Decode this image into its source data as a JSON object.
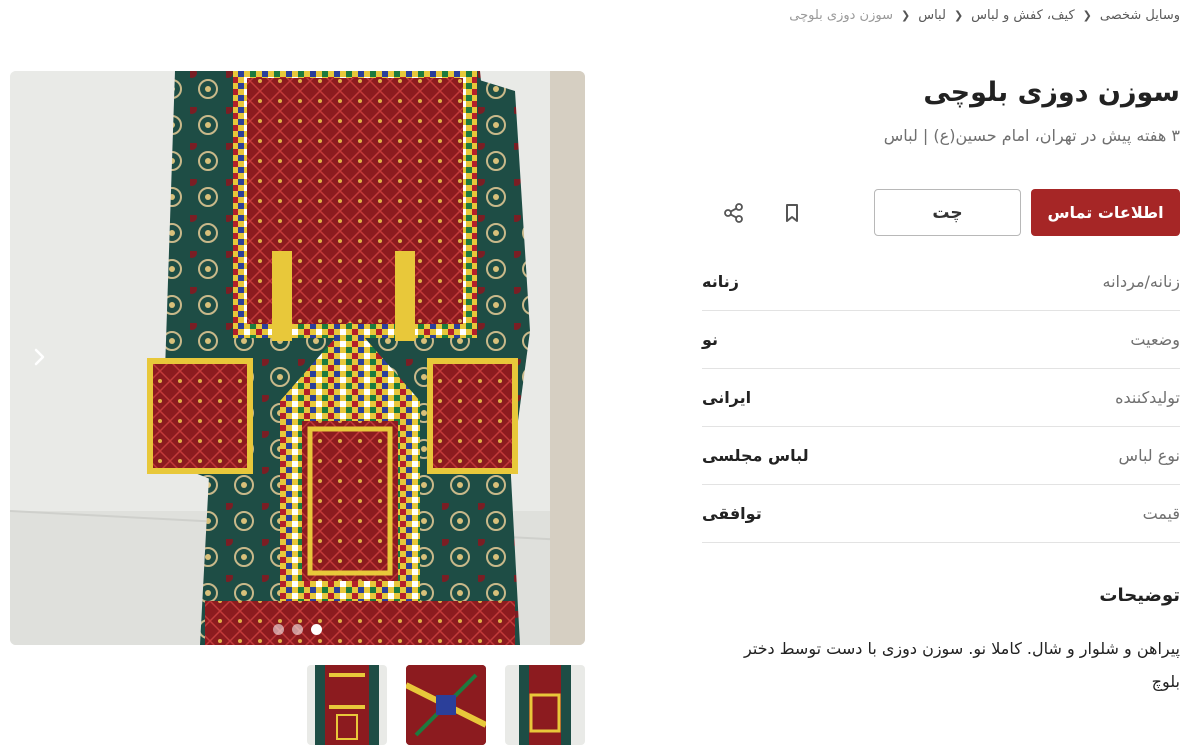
{
  "breadcrumb": {
    "items": [
      "وسایل شخصی",
      "کیف، کفش و لباس",
      "لباس"
    ],
    "current": "سوزن دوزی بلوچی"
  },
  "listing": {
    "title": "سوزن دوزی بلوچی",
    "subtitle": "۳ هفته پیش در تهران، امام حسین(ع) | لباس"
  },
  "actions": {
    "contact_label": "اطلاعات تماس",
    "chat_label": "چت",
    "bookmark_icon": "bookmark-icon",
    "share_icon": "share-icon"
  },
  "attributes": [
    {
      "label": "زنانه/مردانه",
      "value": "زنانه"
    },
    {
      "label": "وضعیت",
      "value": "نو"
    },
    {
      "label": "تولیدکننده",
      "value": "ایرانی"
    },
    {
      "label": "نوع لباس",
      "value": "لباس مجلسی"
    },
    {
      "label": "قیمت",
      "value": "توافقی"
    }
  ],
  "description": {
    "title": "توضیحات",
    "text": "پیراهن و شلوار و شال. کاملا نو. سوزن دوزی با دست توسط دختر بلوچ"
  },
  "gallery": {
    "prev_icon": "chevron-left-icon",
    "dot_count": 3,
    "active_dot": 1,
    "thumbnail_count": 3
  },
  "colors": {
    "primary": "#a62626",
    "embroidery_red": "#8c1b1f",
    "embroidery_green": "#1e4d45",
    "embroidery_yellow": "#e8c83a",
    "wall": "#e9eae7"
  }
}
